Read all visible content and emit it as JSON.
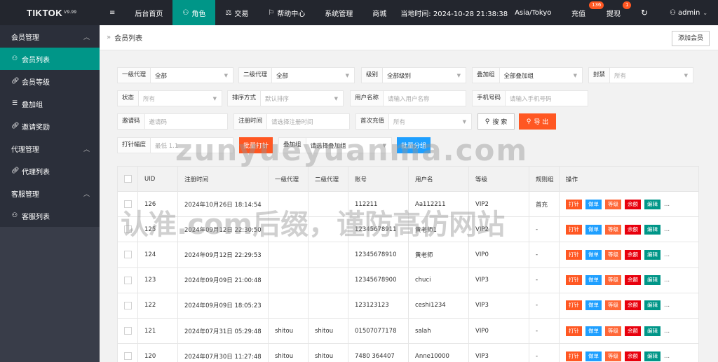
{
  "app": {
    "logo": "TIKTOK",
    "version": "V9.99"
  },
  "topnav": {
    "menu_icon": "≡",
    "items": [
      {
        "label": "后台首页"
      },
      {
        "label": "角色",
        "icon": "user-icon"
      },
      {
        "label": "交易",
        "icon": "scale-icon"
      },
      {
        "label": "帮助中心",
        "icon": "flag-icon"
      },
      {
        "label": "系统管理"
      },
      {
        "label": "商城"
      }
    ],
    "time": "当地时间: 2024-10-28 21:38:38",
    "timezone": "Asia/Tokyo",
    "recharge": "充值",
    "recharge_badge": "136",
    "withdraw": "提现",
    "withdraw_badge": "1",
    "user": "admin"
  },
  "sidebar": {
    "groups": [
      {
        "label": "会员管理",
        "items": [
          {
            "label": "会员列表",
            "active": true,
            "icon": "user-icon"
          },
          {
            "label": "会员等级",
            "icon": "link-icon"
          },
          {
            "label": "叠加组",
            "icon": "list-icon"
          },
          {
            "label": "邀请奖励",
            "icon": "link-icon"
          }
        ]
      },
      {
        "label": "代理管理",
        "items": [
          {
            "label": "代理列表",
            "icon": "link-icon"
          }
        ]
      },
      {
        "label": "客服管理",
        "items": [
          {
            "label": "客服列表",
            "icon": "users-icon"
          }
        ]
      }
    ]
  },
  "breadcrumb": {
    "title": "会员列表",
    "add_button": "添加会员"
  },
  "filters": {
    "agent1": {
      "label": "一级代理",
      "value": "全部"
    },
    "agent2": {
      "label": "二级代理",
      "value": "全部"
    },
    "level": {
      "label": "级别",
      "value": "全部级别"
    },
    "overlay": {
      "label": "叠加组",
      "value": "全部叠加组"
    },
    "ban": {
      "label": "封禁",
      "placeholder": "所有"
    },
    "status": {
      "label": "状态",
      "placeholder": "所有"
    },
    "sort": {
      "label": "排序方式",
      "placeholder": "默认排序"
    },
    "username": {
      "label": "用户名称",
      "placeholder": "请输入用户名称"
    },
    "phone": {
      "label": "手机号码",
      "placeholder": "请输入手机号码"
    },
    "invite": {
      "label": "邀请码",
      "placeholder": "邀请码"
    },
    "regtime": {
      "label": "注册时间",
      "placeholder": "请选择注册时间"
    },
    "firstcharge": {
      "label": "首次充值",
      "placeholder": "所有"
    },
    "search_btn": "搜 索",
    "export_btn": "导 出",
    "range": {
      "label": "打针幅度",
      "placeholder": "最低 1.1"
    },
    "batch_inject": "批量打针",
    "overlay2": {
      "label": "叠加组",
      "value": "请选择叠加组"
    },
    "batch_group": "批量分组"
  },
  "table": {
    "headers": [
      "UID",
      "注册时间",
      "一级代理",
      "二级代理",
      "账号",
      "用户名",
      "等级",
      "规则组",
      "操作"
    ],
    "actions": [
      "打针",
      "做单",
      "等级",
      "余额",
      "编辑",
      "..."
    ],
    "rows": [
      {
        "uid": "126",
        "time": "2024年10月26日 18:14:54",
        "a1": "",
        "a2": "",
        "acct": "112211",
        "name": "Aa112211",
        "level": "VIP2",
        "rule": "首充"
      },
      {
        "uid": "125",
        "time": "2024年09月12日 22:30:50",
        "a1": "",
        "a2": "",
        "acct": "12345678911",
        "name": "黄老师1",
        "level": "VIP2",
        "rule": "-"
      },
      {
        "uid": "124",
        "time": "2024年09月12日 22:29:53",
        "a1": "",
        "a2": "",
        "acct": "12345678910",
        "name": "黄老师",
        "level": "VIP0",
        "rule": "-"
      },
      {
        "uid": "123",
        "time": "2024年09月09日 21:00:48",
        "a1": "",
        "a2": "",
        "acct": "12345678900",
        "name": "chuci",
        "level": "VIP3",
        "rule": "-"
      },
      {
        "uid": "122",
        "time": "2024年09月09日 18:05:23",
        "a1": "",
        "a2": "",
        "acct": "123123123",
        "name": "ceshi1234",
        "level": "VIP3",
        "rule": "-"
      },
      {
        "uid": "121",
        "time": "2024年07月31日 05:29:48",
        "a1": "shitou",
        "a2": "shitou",
        "acct": "01507077178",
        "name": "salah",
        "level": "VIP0",
        "rule": "-"
      },
      {
        "uid": "120",
        "time": "2024年07月30日 11:27:48",
        "a1": "shitou",
        "a2": "shitou",
        "acct": "7480 364407",
        "name": "Anne10000",
        "level": "VIP3",
        "rule": "-"
      }
    ]
  },
  "watermark": {
    "line1": "zunyueyuanma.com",
    "line2": "认准.com后缀，谨防高仿网站"
  }
}
